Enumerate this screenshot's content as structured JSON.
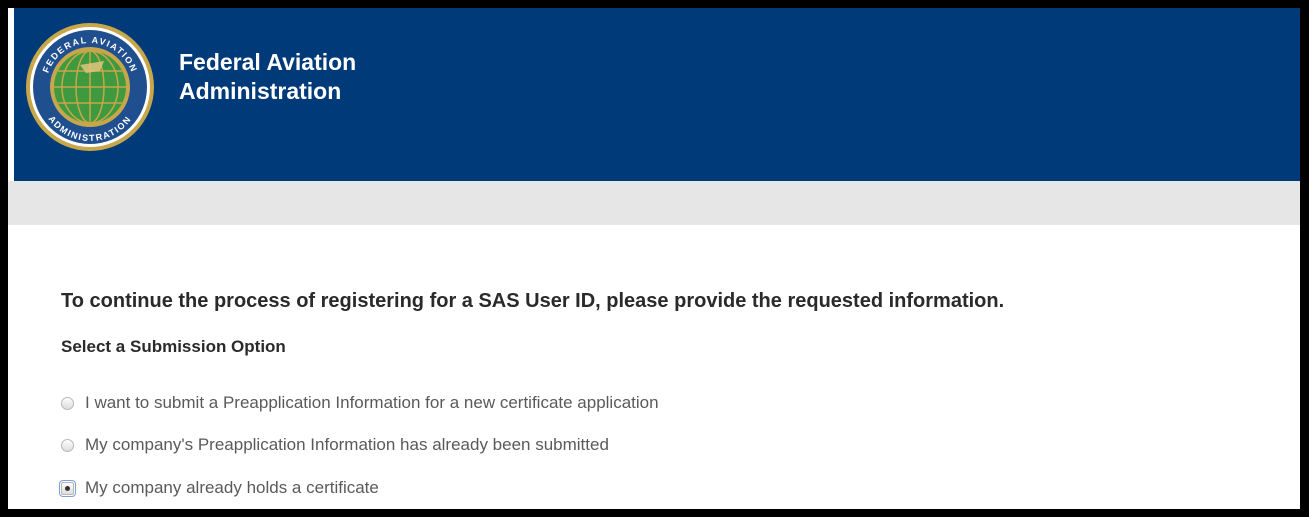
{
  "header": {
    "agency_name_line1": "Federal Aviation",
    "agency_name_line2": "Administration",
    "seal_text_top": "FEDERAL AVIATION",
    "seal_text_bottom": "ADMINISTRATION",
    "colors": {
      "header_bg": "#003a78",
      "subbar_bg": "#e6e6e6",
      "seal_gold": "#c8a64a",
      "seal_blue": "#1f4f8f",
      "seal_green": "#3f9a3f"
    }
  },
  "main": {
    "intro": "To continue the process of registering for a SAS User ID, please provide the requested information.",
    "section_title": "Select a Submission Option",
    "options": [
      {
        "label": "I want to submit a Preapplication Information for a new certificate application",
        "selected": false
      },
      {
        "label": "My company's Preapplication Information has already been submitted",
        "selected": false
      },
      {
        "label": "My company already holds a certificate",
        "selected": true
      }
    ]
  }
}
